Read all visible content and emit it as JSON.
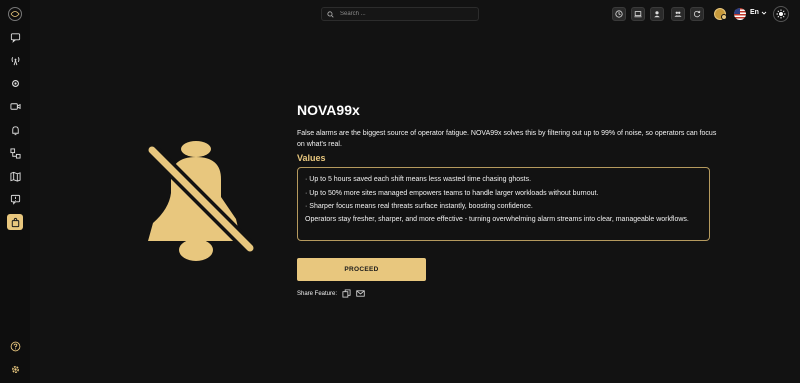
{
  "header": {
    "search_placeholder": "Search ...",
    "language": "En"
  },
  "sidebar": {
    "items": [
      {
        "icon": "chat-icon"
      },
      {
        "icon": "antenna-icon"
      },
      {
        "icon": "settings-gear-icon"
      },
      {
        "icon": "camera-icon"
      },
      {
        "icon": "bell-icon"
      },
      {
        "icon": "workflow-icon"
      },
      {
        "icon": "map-icon"
      },
      {
        "icon": "message-alert-icon"
      },
      {
        "icon": "shopping-bag-icon",
        "active": true
      }
    ],
    "bottom": [
      {
        "icon": "help-icon"
      },
      {
        "icon": "gear-icon"
      }
    ]
  },
  "feature": {
    "title": "NOVA99x",
    "description": "False alarms are the biggest source of operator fatigue. NOVA99x solves this by filtering out up to 99% of noise, so operators can focus on what's real.",
    "values_heading": "Values",
    "values": [
      "· Up to 5 hours saved each shift means less wasted time chasing ghosts.",
      "· Up to 50% more sites managed empowers teams to handle larger workloads without burnout.",
      "· Sharper focus means real threats surface instantly, boosting confidence."
    ],
    "summary": "Operators stay fresher, sharper, and more effective - turning overwhelming alarm streams into clear, manageable workflows.",
    "proceed_label": "PROCEED",
    "share_label": "Share Feature:"
  },
  "colors": {
    "accent": "#e8c77e",
    "background": "#121212",
    "border": "#b59a5e"
  }
}
